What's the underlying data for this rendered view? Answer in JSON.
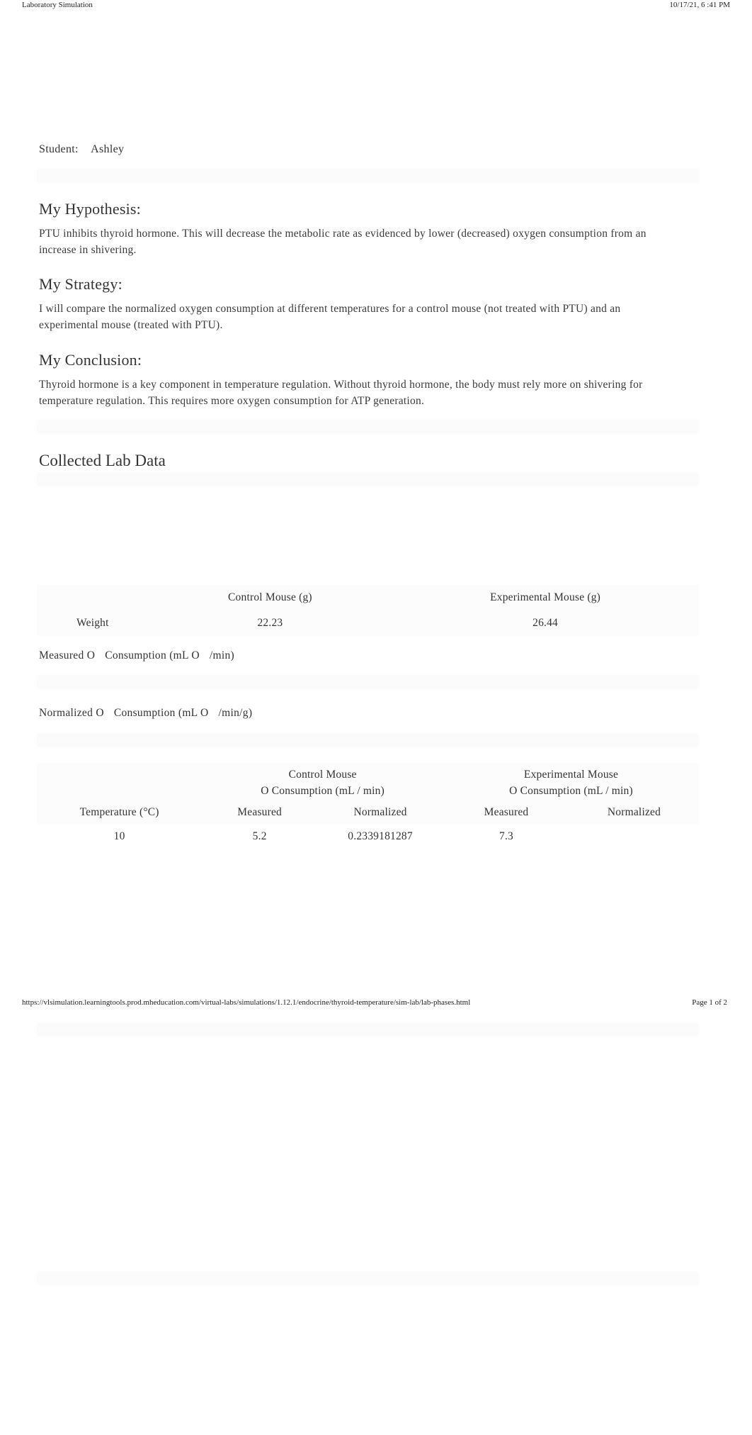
{
  "print_header": {
    "title": "Laboratory Simulation",
    "timestamp": "10/17/21, 6 :41 PM"
  },
  "student": {
    "label": "Student:",
    "name": "Ashley"
  },
  "hypothesis": {
    "title": "My Hypothesis:",
    "body": "PTU inhibits thyroid hormone. This will decrease the metabolic rate as evidenced by lower (decreased) oxygen consumption from an increase in shivering."
  },
  "strategy": {
    "title": "My Strategy:",
    "body": "I will compare the normalized oxygen consumption at different temperatures for a control mouse (not treated with PTU) and an experimental mouse (treated with PTU)."
  },
  "conclusion": {
    "title": "My Conclusion:",
    "body": "Thyroid hormone is a key component in temperature regulation. Without thyroid hormone, the body must rely more on shivering for temperature regulation. This requires more oxygen consumption for ATP generation."
  },
  "lab_data": {
    "title": "Collected Lab Data",
    "weight_table": {
      "headers": [
        "",
        "Control Mouse (g)",
        "Experimental Mouse (g)"
      ],
      "row": {
        "label": "Weight",
        "control": "22.23",
        "experimental": "26.44"
      }
    },
    "measured_label": {
      "part1": "Measured O",
      "part2": "Consumption (mL O",
      "part3": "/min)"
    },
    "normalized_label": {
      "part1": "Normalized O",
      "part2": "Consumption (mL O",
      "part3": "/min/g)"
    },
    "o2_table": {
      "group_headers": [
        {
          "line1": "Control Mouse",
          "line2": "O  Consumption (mL / min)"
        },
        {
          "line1": "Experimental Mouse",
          "line2": "O  Consumption (mL / min)"
        }
      ],
      "sub_headers": [
        "Temperature (°C)",
        "Measured",
        "Normalized",
        "Measured",
        "Normalized"
      ],
      "rows": [
        {
          "temperature": "10",
          "control_measured": "5.2",
          "control_normalized": "0.2339181287",
          "experimental_measured": "7.3",
          "experimental_normalized": ""
        }
      ]
    }
  },
  "print_footer": {
    "url": "https://vlsimulation.learningtools.prod.mheducation.com/virtual-labs/simulations/1.12.1/endocrine/thyroid-temperature/sim-lab/lab-phases.html",
    "page": "Page 1 of 2"
  }
}
